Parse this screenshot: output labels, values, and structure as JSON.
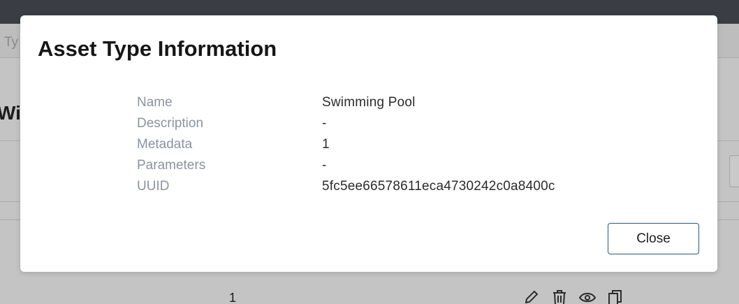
{
  "background": {
    "subbar_text": "Ty",
    "heading_fragment": "Win",
    "row_value": "1"
  },
  "modal": {
    "title": "Asset Type Information",
    "fields": [
      {
        "label": "Name",
        "value": "Swimming Pool"
      },
      {
        "label": "Description",
        "value": "-"
      },
      {
        "label": "Metadata",
        "value": "1"
      },
      {
        "label": "Parameters",
        "value": "-"
      },
      {
        "label": "UUID",
        "value": "5fc5ee66578611eca4730242c0a8400c"
      }
    ],
    "close_label": "Close"
  },
  "icons": [
    "pencil-icon",
    "trash-icon",
    "eye-icon",
    "copy-icon"
  ],
  "colors": {
    "topbar": "#3a3d44",
    "overlay": "#c4c4c4",
    "label": "#8b93a1",
    "button_border": "#2d5876"
  }
}
